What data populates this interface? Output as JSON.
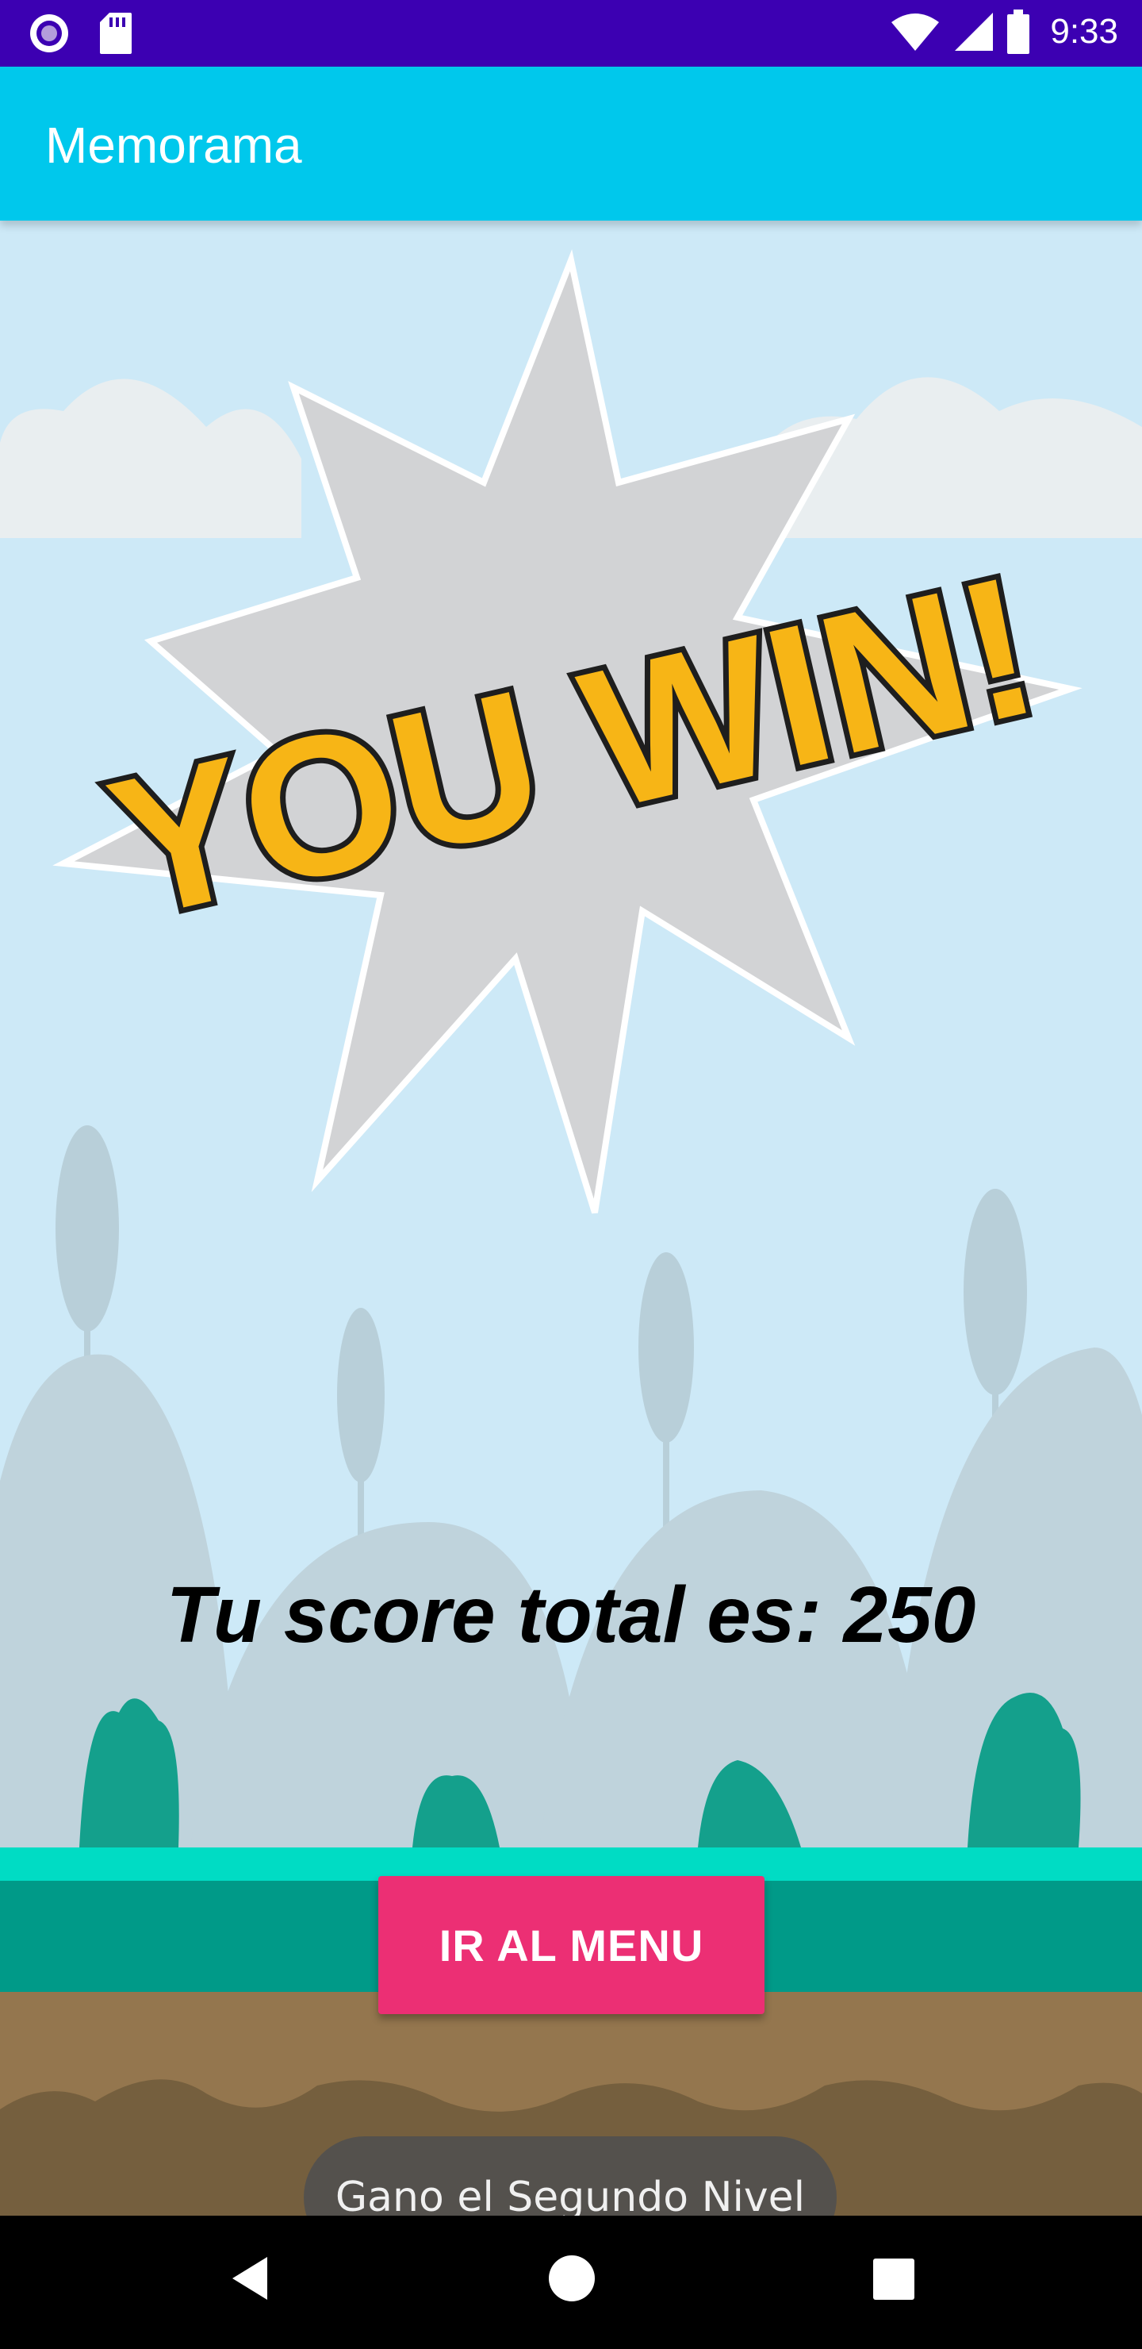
{
  "status_bar": {
    "time": "9:33",
    "left_icons": [
      "notification-circle-icon",
      "sd-card-icon"
    ],
    "right_icons": [
      "wifi-icon",
      "signal-icon",
      "battery-icon"
    ]
  },
  "app_bar": {
    "title": "Memorama"
  },
  "main": {
    "banner_text": "YOU WIN!",
    "score_text": "Tu score total es: 250",
    "menu_button_label": "IR AL MENU"
  },
  "toast": {
    "message": "Gano el Segundo Nivel"
  },
  "nav_bar": {
    "buttons": [
      "back-icon",
      "home-icon",
      "recents-icon"
    ]
  },
  "colors": {
    "status_bar": "#3c00b2",
    "app_bar": "#00c8ec",
    "button": "#ec2f74",
    "sky": "#cde9f7",
    "grass": "#00dcc4",
    "ground": "#8e7550"
  }
}
